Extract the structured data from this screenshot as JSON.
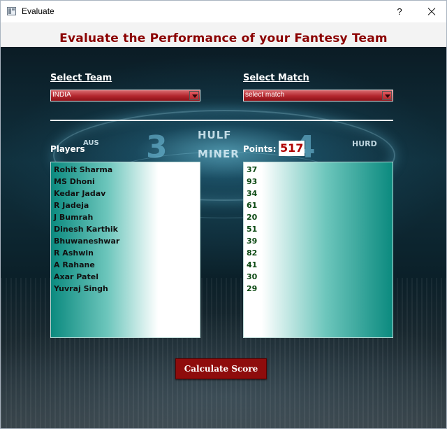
{
  "window": {
    "title": "Evaluate",
    "help_label": "?",
    "icon": "app-window-icon"
  },
  "page": {
    "title": "Evaluate the Performance of your Fantesy Team"
  },
  "background": {
    "glyphs": [
      "3",
      "4",
      "HULF",
      "MINER",
      "HURD",
      "AUS"
    ]
  },
  "team": {
    "label": "Select Team",
    "selected": "INDIA"
  },
  "match": {
    "label": "Select Match",
    "selected": "select match"
  },
  "players": {
    "label": "Players",
    "items": [
      "Rohit Sharma",
      "MS Dhoni",
      "Kedar Jadav",
      "R Jadeja",
      "J Bumrah",
      "Dinesh Karthik",
      "Bhuwaneshwar",
      "R Ashwin",
      "A Rahane",
      "Axar Patel",
      "Yuvraj Singh"
    ]
  },
  "points": {
    "label": "Points:",
    "total": "517",
    "items": [
      "37",
      "93",
      "34",
      "61",
      "20",
      "51",
      "39",
      "82",
      "41",
      "30",
      "29"
    ]
  },
  "actions": {
    "calculate_label": "Calculate Score"
  },
  "colors": {
    "title_text": "#8b0000",
    "combo_red": "#b3262d",
    "button_red": "#8e0c0c",
    "points_total": "#b00000",
    "list_teal": "#0b8a7f",
    "points_text": "#0d4a14"
  }
}
